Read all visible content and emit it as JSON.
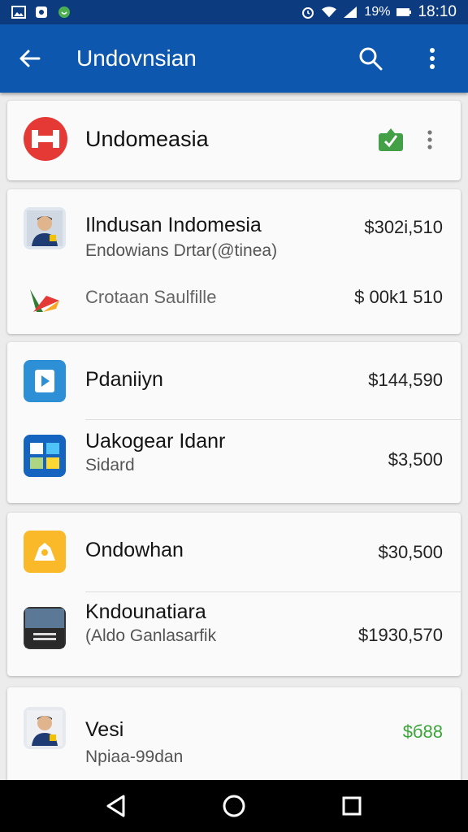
{
  "status_bar": {
    "battery_percent": "19%",
    "time": "18:10",
    "icons": [
      "image-icon",
      "app-icon",
      "whatsapp-icon",
      "alarm-icon",
      "wifi-icon",
      "signal-icon",
      "battery-icon"
    ]
  },
  "app_bar": {
    "title": "Undovnsian",
    "icons": [
      "back-arrow-icon",
      "search-icon",
      "more-vert-icon"
    ]
  },
  "header_card": {
    "title": "Undomeasia",
    "icons": [
      "logo-icon",
      "green-badge-icon",
      "more-vert-icon"
    ]
  },
  "cards": [
    {
      "rows": [
        {
          "title": "Ilndusan Indomesia",
          "subtitle": "Endowians Drtar(@tinea)",
          "amount": "$302i,510",
          "icon": "person-avatar-icon"
        },
        {
          "title": "",
          "subtitle": "Crotaan Saulfille",
          "amount": "$ 00k1 510",
          "icon": "colorful-arrow-icon"
        }
      ]
    },
    {
      "rows": [
        {
          "title": "Pdaniiyn",
          "subtitle": "",
          "amount": "$144,590",
          "icon": "play-app-icon"
        },
        {
          "title": "Uakogear Idanr",
          "subtitle": "Sidard",
          "amount": "$3,500",
          "icon": "spreadsheet-app-icon"
        }
      ]
    },
    {
      "rows": [
        {
          "title": "Ondowhan",
          "subtitle": "",
          "amount": "$30,500",
          "icon": "yellow-app-icon"
        },
        {
          "title": "Kndounatiara",
          "subtitle": "(Aldo Ganlasarfik",
          "amount": "$1930,570",
          "icon": "photo-card-icon"
        }
      ]
    },
    {
      "rows": [
        {
          "title": "Vesi",
          "subtitle": "Npiaa-99dan",
          "amount": "$б88",
          "icon": "person-avatar-icon"
        }
      ]
    }
  ],
  "colors": {
    "status_bar": "#0c3b80",
    "app_bar": "#0d58ae",
    "positive_amount": "#3aa63a",
    "logo_red": "#e53935"
  },
  "nav_bar": {
    "icons": [
      "back-triangle-icon",
      "home-circle-icon",
      "recents-square-icon"
    ]
  }
}
